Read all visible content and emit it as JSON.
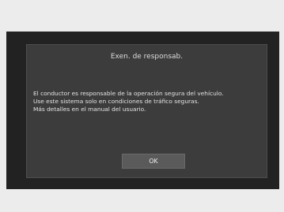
{
  "dialog": {
    "title": "Exen. de responsab.",
    "lines": [
      "El conductor es responsable de la operación segura del vehículo.",
      "Use este sistema solo en condiciones de tráfico seguras.",
      "Más detalles en el manual del usuario."
    ],
    "ok_label": "OK"
  },
  "colors": {
    "page_bg": "#ececec",
    "screen_bg": "#222222",
    "dialog_bg": "#3c3c3c",
    "button_bg": "#5a5a5a",
    "text": "#e4e4e4"
  }
}
